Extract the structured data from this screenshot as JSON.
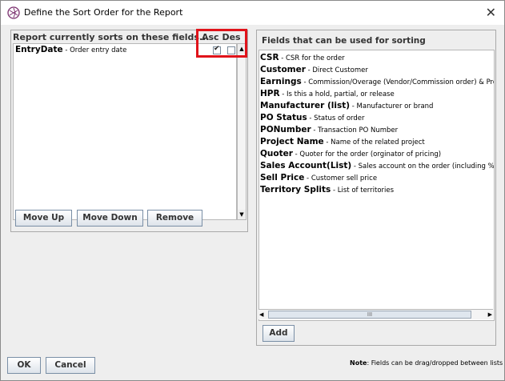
{
  "window": {
    "title": "Define the Sort Order for the Report",
    "close_label": "✕"
  },
  "left_panel": {
    "header": "Report currently sorts on these fields...",
    "asc_label": "Asc",
    "des_label": "Des",
    "rows": [
      {
        "name": "EntryDate",
        "description": " - Order entry date",
        "asc": true,
        "des": false
      }
    ],
    "buttons": {
      "move_up": "Move Up",
      "move_down": "Move Down",
      "remove": "Remove"
    }
  },
  "right_panel": {
    "header": "Fields that can be used for sorting",
    "items": [
      {
        "name": "CSR",
        "description": " - CSR for the order"
      },
      {
        "name": "Customer",
        "description": " - Direct Customer"
      },
      {
        "name": "Earnings",
        "description": " - Commission/Overage (Vendor/Commission order) & Profit (Cus"
      },
      {
        "name": "HPR",
        "description": " - Is this a hold, partial, or release"
      },
      {
        "name": "Manufacturer (list)",
        "description": " - Manufacturer or brand"
      },
      {
        "name": "PO Status",
        "description": " - Status of order"
      },
      {
        "name": "PONumber",
        "description": " - Transaction PO Number"
      },
      {
        "name": "Project Name",
        "description": " - Name of the related project"
      },
      {
        "name": "Quoter",
        "description": " - Quoter for the order (orginator of pricing)"
      },
      {
        "name": "Sales Account(List)",
        "description": " - Sales account on the order (including %)"
      },
      {
        "name": "Sell Price",
        "description": " - Customer sell price"
      },
      {
        "name": "Territory Splits",
        "description": " - List of territories"
      }
    ],
    "add_label": "Add"
  },
  "footer": {
    "ok_label": "OK",
    "cancel_label": "Cancel",
    "note_bold": "Note",
    "note_text": ": Fields can be drag/dropped between lists"
  },
  "colors": {
    "highlight_box": "#e0131a",
    "window_bg": "#eeeeee"
  },
  "icons": {
    "app": "aperture-icon",
    "scroll_up": "triangle-up-icon",
    "scroll_down": "triangle-down-icon",
    "scroll_left": "triangle-left-icon",
    "scroll_right": "triangle-right-icon"
  }
}
